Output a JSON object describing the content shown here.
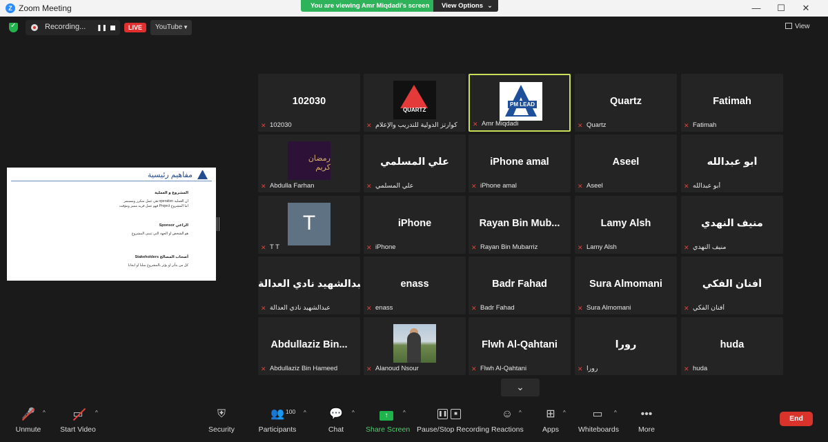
{
  "window": {
    "title": "Zoom Meeting",
    "banner_text": "You are viewing Amr Miqdadi's screen",
    "view_options": "View Options",
    "min": "—",
    "max": "☐",
    "close": "✕"
  },
  "topbar": {
    "recording": "Recording...",
    "live": "LIVE",
    "stream": "YouTube",
    "view": "View"
  },
  "slide": {
    "title": "مفاهيم رئيسية",
    "h1": "المشروع و العملية",
    "b1a": "ان العملية operation هي عمل متكرر ومستمر",
    "b1b": "اما المشروع Project فهو عمل فريد مميز ومؤقت",
    "h2": "الراعي Sponsor",
    "b2": "هو الشخص او الجهة التي تتبنى المشروع",
    "h3": "أصحاب المصالح Stakeholders",
    "b3": "كل من يتأثر او يؤثر بالمشروع سلبا او ايجابا"
  },
  "participants": [
    {
      "big": "102030",
      "name": "102030"
    },
    {
      "pic": "quartz",
      "pic_label": "QUARTZ",
      "name": "كوارتز الدولية للتدريب والإعلام"
    },
    {
      "pic": "pm",
      "pic_label": "PM LEAD",
      "name": "Amr Miqdadi",
      "active": true
    },
    {
      "big": "Quartz",
      "name": "Quartz"
    },
    {
      "big": "Fatimah",
      "name": "Fatimah"
    },
    {
      "pic": "purple",
      "pic_label": "رمضان كريم",
      "name": "Abdulla Farhan"
    },
    {
      "big": "علي المسلمي",
      "name": "علي المسلمي"
    },
    {
      "big": "iPhone amal",
      "name": "iPhone amal"
    },
    {
      "big": "Aseel",
      "name": "Aseel"
    },
    {
      "big": "أبو عبدالله",
      "name": "أبو عبدالله"
    },
    {
      "pic": "t",
      "pic_label": "T",
      "name": "T T"
    },
    {
      "big": "iPhone",
      "name": "iPhone"
    },
    {
      "big": "Rayan Bin Mub...",
      "name": "Rayan Bin Mubarriz"
    },
    {
      "big": "Lamy Alsh",
      "name": "Lamy Alsh"
    },
    {
      "big": "منيف النهدي",
      "name": "منيف النهدي"
    },
    {
      "big": "عبدالشهيد نادي العدالة",
      "name": "عبدالشهيد نادي العدالة"
    },
    {
      "big": "enass",
      "name": "enass"
    },
    {
      "big": "Badr Fahad",
      "name": "Badr Fahad"
    },
    {
      "big": "Sura Almomani",
      "name": "Sura Almomani"
    },
    {
      "big": "أفنان الفكي",
      "name": "أفنان الفكي"
    },
    {
      "big": "Abdullaziz Bin...",
      "name": "Abdullaziz Bin Hameed"
    },
    {
      "pic": "photo",
      "name": "Alanoud Nsour"
    },
    {
      "big": "Flwh Al-Qahtani",
      "name": "Flwh Al-Qahtani"
    },
    {
      "big": "رورا",
      "name": "رورا"
    },
    {
      "big": "huda",
      "name": "huda"
    }
  ],
  "more_arrow": "⌄",
  "toolbar": {
    "unmute": "Unmute",
    "start_video": "Start Video",
    "security": "Security",
    "participants": "Participants",
    "participants_count": "100",
    "chat": "Chat",
    "share_screen": "Share Screen",
    "pause_stop": "Pause/Stop Recording",
    "reactions": "Reactions",
    "apps": "Apps",
    "whiteboards": "Whiteboards",
    "more": "More",
    "end": "End"
  },
  "colors": {
    "banner": "#2fb35a",
    "active_border": "#c8e05a",
    "muted_icon": "#e5413b",
    "end_button": "#d9332c"
  }
}
